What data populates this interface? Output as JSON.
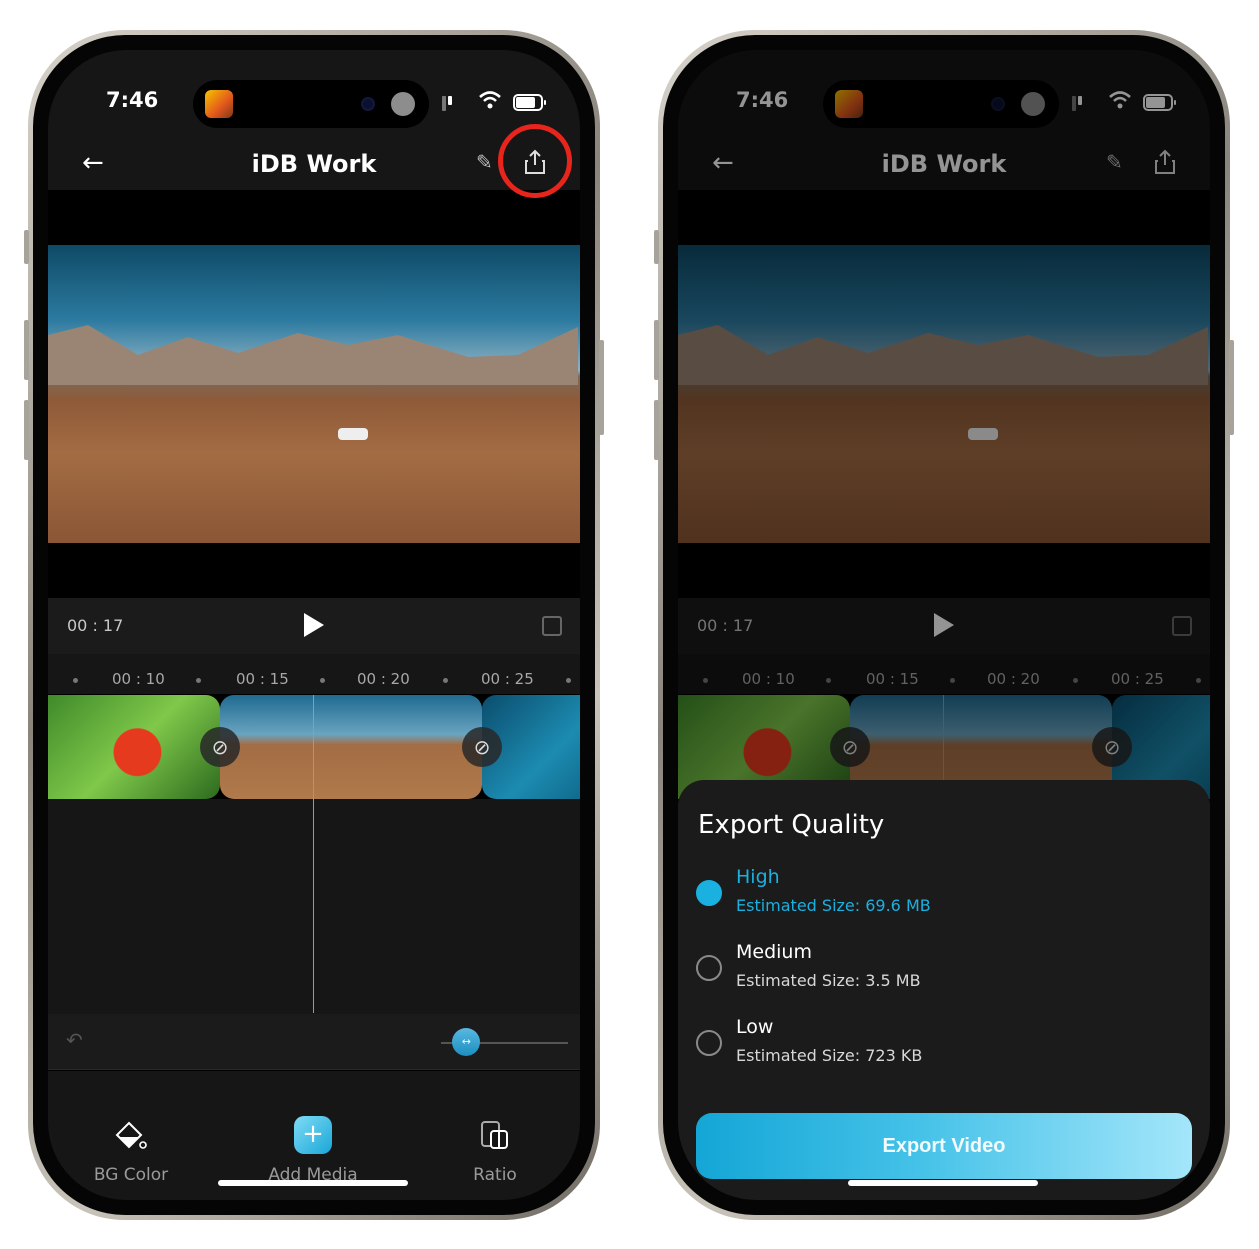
{
  "status_bar": {
    "time": "7:46"
  },
  "header": {
    "title": "iDB Work"
  },
  "player": {
    "current_time": "00 : 17",
    "ruler_ticks": [
      "00 : 10",
      "00 : 15",
      "00 : 20",
      "00 : 25"
    ]
  },
  "timeline": {
    "clips": [
      {
        "name": "strawberry"
      },
      {
        "name": "desert-drive"
      },
      {
        "name": "ocean-aerial"
      }
    ]
  },
  "zoom_slider": {
    "value": 0.2
  },
  "toolbar": {
    "items": [
      {
        "label": "BG Color",
        "icon": "paint-bucket-icon"
      },
      {
        "label": "Add Media",
        "icon": "plus-icon"
      },
      {
        "label": "Ratio",
        "icon": "ratio-icon"
      }
    ]
  },
  "export_sheet": {
    "title": "Export Quality",
    "options": [
      {
        "name": "High",
        "size": "Estimated Size: 69.6 MB",
        "selected": true
      },
      {
        "name": "Medium",
        "size": "Estimated Size: 3.5 MB",
        "selected": false
      },
      {
        "name": "Low",
        "size": "Estimated Size: 723 KB",
        "selected": false
      }
    ],
    "button_label": "Export Video"
  },
  "colors": {
    "accent": "#1ab0e0",
    "highlight_ring": "#e8251c",
    "background": "#161616"
  }
}
